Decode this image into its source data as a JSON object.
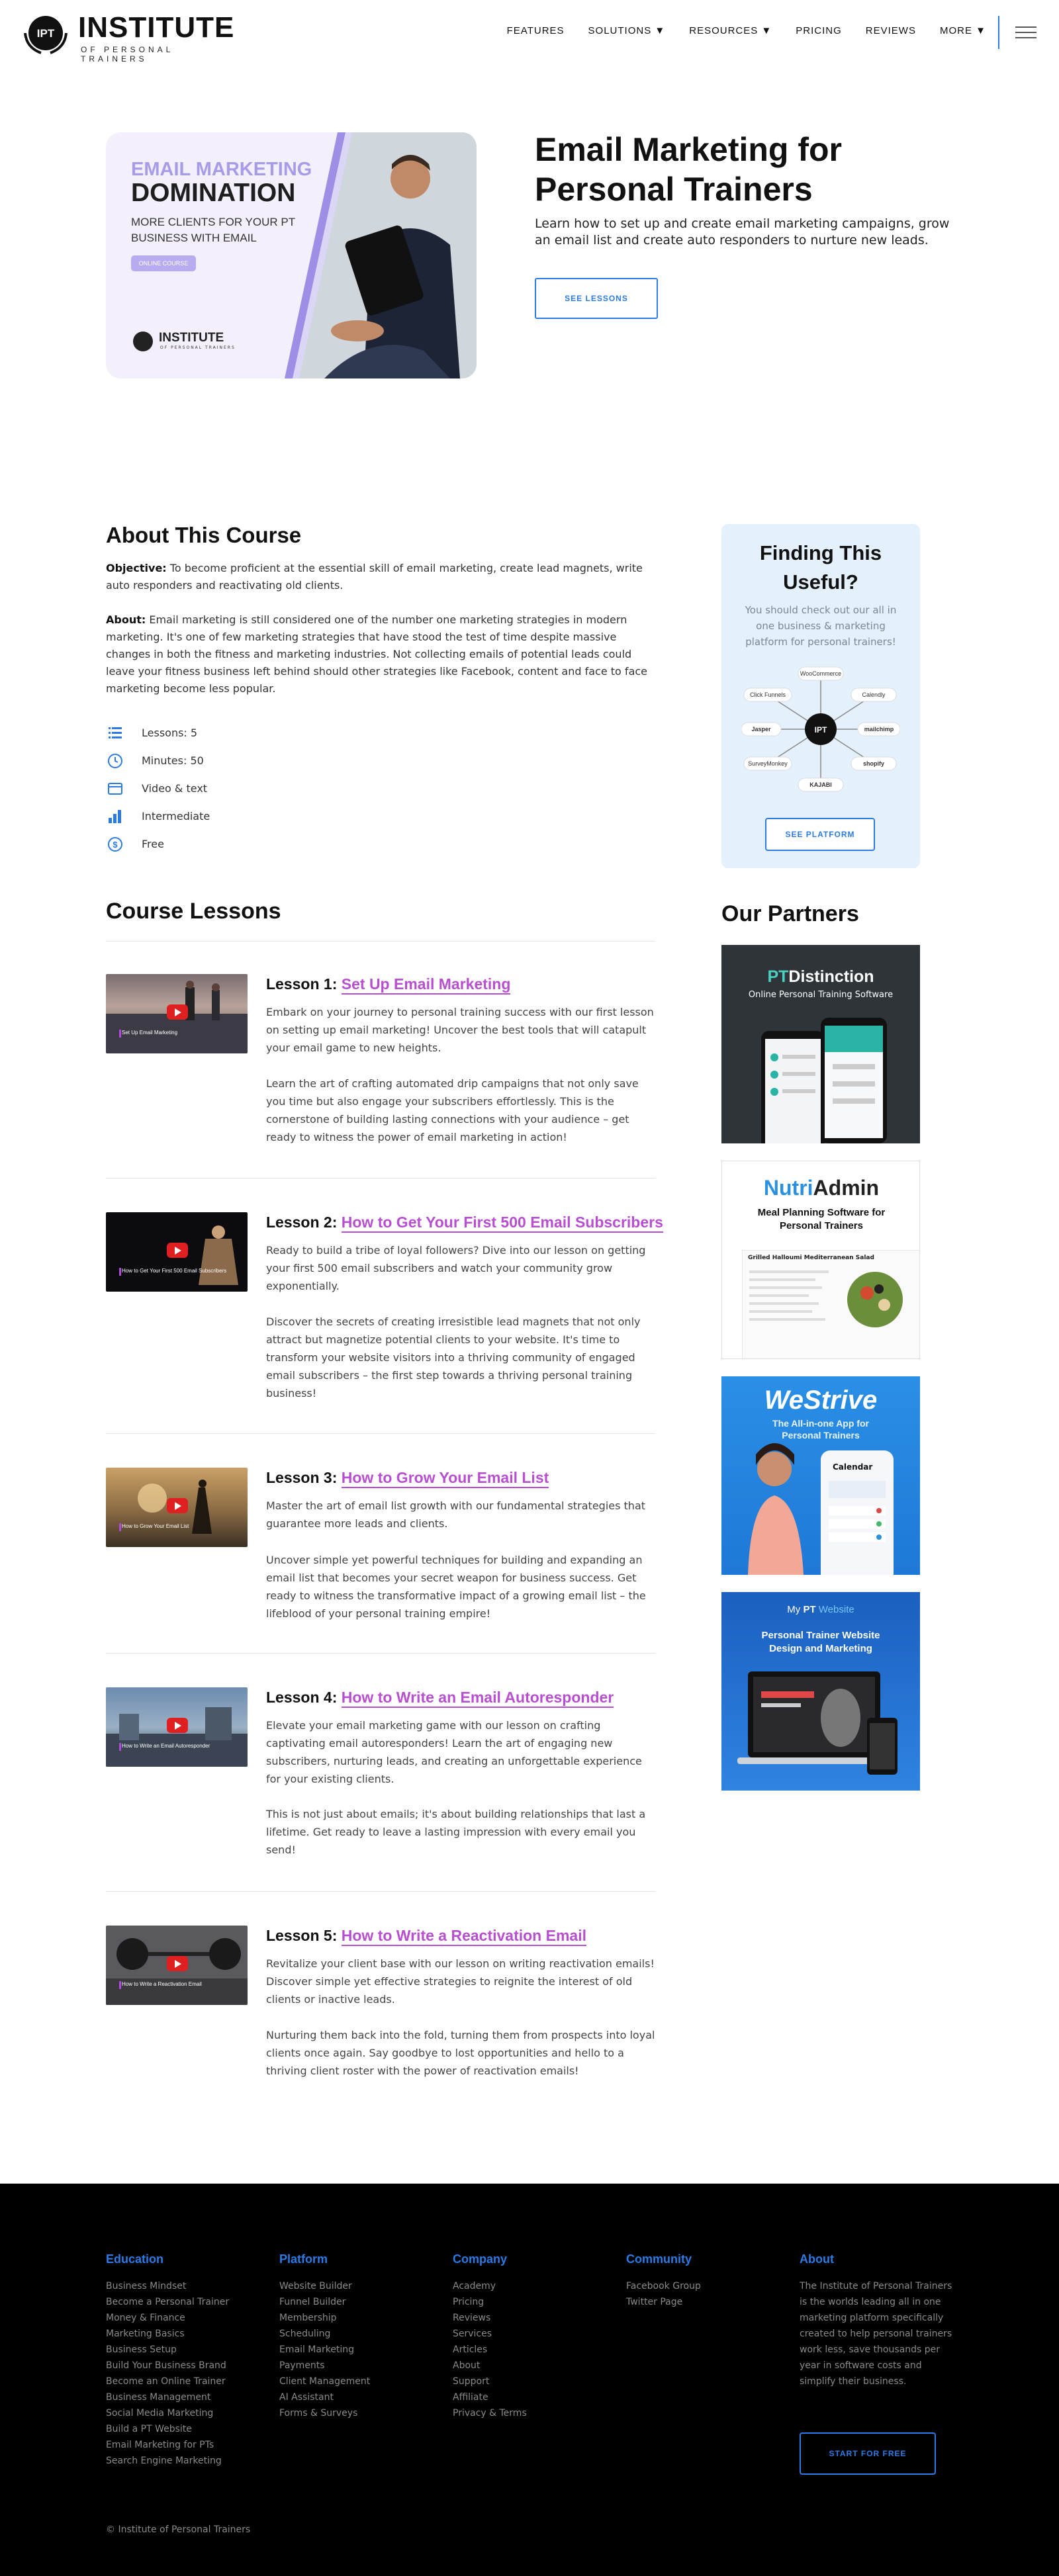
{
  "header": {
    "logo_seal": "IPT",
    "logo_main": "INSTITUTE",
    "logo_sub": "OF PERSONAL TRAINERS",
    "nav": [
      "FEATURES",
      "SOLUTIONS ▼",
      "RESOURCES ▼",
      "PRICING",
      "REVIEWS",
      "MORE ▼"
    ],
    "menu_icon": "hamburger-icon"
  },
  "hero": {
    "image_kicker": "EMAIL MARKETING",
    "image_title": "DOMINATION",
    "image_tagline": "MORE CLIENTS FOR YOUR PT BUSINESS WITH EMAIL",
    "image_pill": "ONLINE COURSE",
    "image_logo": "INSTITUTE",
    "image_logo_sub": "OF PERSONAL TRAINERS",
    "title": "Email Marketing for Personal Trainers",
    "description": "Learn how to set up and create email marketing campaigns, grow an email list and create auto responders to nurture new leads.",
    "button": "SEE LESSONS"
  },
  "about": {
    "title": "About This Course",
    "objective_label": "Objective:",
    "objective": "To become proficient at the essential skill of email marketing, create lead magnets, write auto responders and reactivating old clients.",
    "about_label": "About:",
    "about": "Email marketing is still considered one of the number one marketing strategies in modern marketing. It's one of few marketing strategies that have stood the test of time despite massive changes in both the fitness and marketing industries. Not collecting emails of potential leads could leave your fitness business left behind should other strategies like Facebook, content and face to face marketing become less popular.",
    "features": [
      {
        "icon": "list-icon",
        "label": "Lessons: 5"
      },
      {
        "icon": "clock-icon",
        "label": "Minutes: 50"
      },
      {
        "icon": "video-icon",
        "label": "Video & text"
      },
      {
        "icon": "bar-chart-icon",
        "label": "Intermediate"
      },
      {
        "icon": "dollar-icon",
        "label": "Free"
      }
    ]
  },
  "sidebar_card": {
    "title": "Finding This Useful?",
    "description": "You should check out our all in one business & marketing platform for personal trainers!",
    "platforms": [
      "WooCommerce",
      "Click Funnels",
      "Calendly",
      "Jasper",
      "mailchimp",
      "SurveyMonkey",
      "shopify",
      "KAJABI"
    ],
    "hub": "IPT",
    "button": "SEE PLATFORM"
  },
  "lessons": {
    "title": "Course Lessons",
    "items": [
      {
        "prefix": "Lesson 1:",
        "name": "Set Up Email Marketing",
        "thumb_caption": "Set Up Email Marketing",
        "p1": "Embark on your journey to personal training success with our first lesson on setting up email marketing! Uncover the best tools that will catapult your email game to new heights.",
        "p2": "Learn the art of crafting automated drip campaigns that not only save you time but also engage your subscribers effortlessly. This is the cornerstone of building lasting connections with your audience – get ready to witness the power of email marketing in action!"
      },
      {
        "prefix": "Lesson 2:",
        "name": "How to Get Your First 500 Email Subscribers",
        "thumb_caption": "How to Get Your First 500 Email Subscribers",
        "p1": "Ready to build a tribe of loyal followers? Dive into our lesson on getting your first 500 email subscribers and watch your community grow exponentially.",
        "p2": "Discover the secrets of creating irresistible lead magnets that not only attract but magnetize potential clients to your website. It's time to transform your website visitors into a thriving community of engaged email subscribers – the first step towards a thriving personal training business!"
      },
      {
        "prefix": "Lesson 3:",
        "name": "How to Grow Your Email List",
        "thumb_caption": "How to Grow Your Email List",
        "p1": "Master the art of email list growth with our fundamental strategies that guarantee more leads and clients.",
        "p2": "Uncover simple yet powerful techniques for building and expanding an email list that becomes your secret weapon for business success. Get ready to witness the transformative impact of a growing email list – the lifeblood of your personal training empire!"
      },
      {
        "prefix": "Lesson 4:",
        "name": "How to Write an Email Autoresponder",
        "thumb_caption": "How to Write an Email Autoresponder",
        "p1": "Elevate your email marketing game with our lesson on crafting captivating email autoresponders! Learn the art of engaging new subscribers, nurturing leads, and creating an unforgettable experience for your existing clients.",
        "p2": "This is not just about emails; it's about building relationships that last a lifetime. Get ready to leave a lasting impression with every email you send!"
      },
      {
        "prefix": "Lesson 5:",
        "name": "How to Write a Reactivation Email",
        "thumb_caption": "How to Write a Reactivation Email",
        "p1": "Revitalize your client base with our lesson on writing reactivation emails! Discover simple yet effective strategies to reignite the interest of old clients or inactive leads.",
        "p2": "Nurturing them back into the fold, turning them from prospects into loyal clients once again. Say goodbye to lost opportunities and hello to a thriving client roster with the power of reactivation emails!"
      }
    ]
  },
  "partners": {
    "title": "Our Partners",
    "ptd": {
      "name_a": "PT",
      "name_b": "Distinction",
      "tagline": "Online Personal Training Software"
    },
    "nutri": {
      "name_a": "Nutri",
      "name_b": "Admin",
      "tagline": "Meal Planning Software for Personal Trainers",
      "recipe": "Grilled Halloumi Mediterranean Salad"
    },
    "westrive": {
      "name": "WeStrive",
      "tagline": "The All-in-one App for Personal Trainers",
      "calendar": "Calendar"
    },
    "mypt": {
      "brand_a": "My",
      "brand_b": "PT",
      "brand_c": "Website",
      "tagline": "Personal Trainer Website Design and Marketing"
    }
  },
  "footer": {
    "columns": [
      {
        "title": "Education",
        "links": [
          "Business Mindset",
          "Become a Personal Trainer",
          "Money & Finance",
          "Marketing Basics",
          "Business Setup",
          "Build Your Business Brand",
          "Become an Online Trainer",
          "Business Management",
          "Social Media Marketing",
          "Build a PT Website",
          "Email Marketing for PTs",
          "Search Engine Marketing"
        ]
      },
      {
        "title": "Platform",
        "links": [
          "Website Builder",
          "Funnel Builder",
          "Membership",
          "Scheduling",
          "Email Marketing",
          "Payments",
          "Client Management",
          "AI Assistant",
          "Forms & Surveys"
        ]
      },
      {
        "title": "Company",
        "links": [
          "Academy",
          "Pricing",
          "Reviews",
          "Services",
          "Articles",
          "About",
          "Support",
          "Affiliate",
          "Privacy & Terms"
        ]
      },
      {
        "title": "Community",
        "links": [
          "Facebook Group",
          "Twitter Page"
        ]
      }
    ],
    "about_title": "About",
    "about_text": "The Institute of Personal Trainers is the worlds leading all in one marketing platform specifically created to help personal trainers work less, save thousands per year in software costs and simplify their business.",
    "cta": "START FOR FREE",
    "copyright": "© Institute of Personal Trainers"
  },
  "colors": {
    "accent": "#2c7be5",
    "lesson_link": "#b84fd0",
    "card_bg": "#e4f0fb",
    "footer_bg": "#000000"
  }
}
